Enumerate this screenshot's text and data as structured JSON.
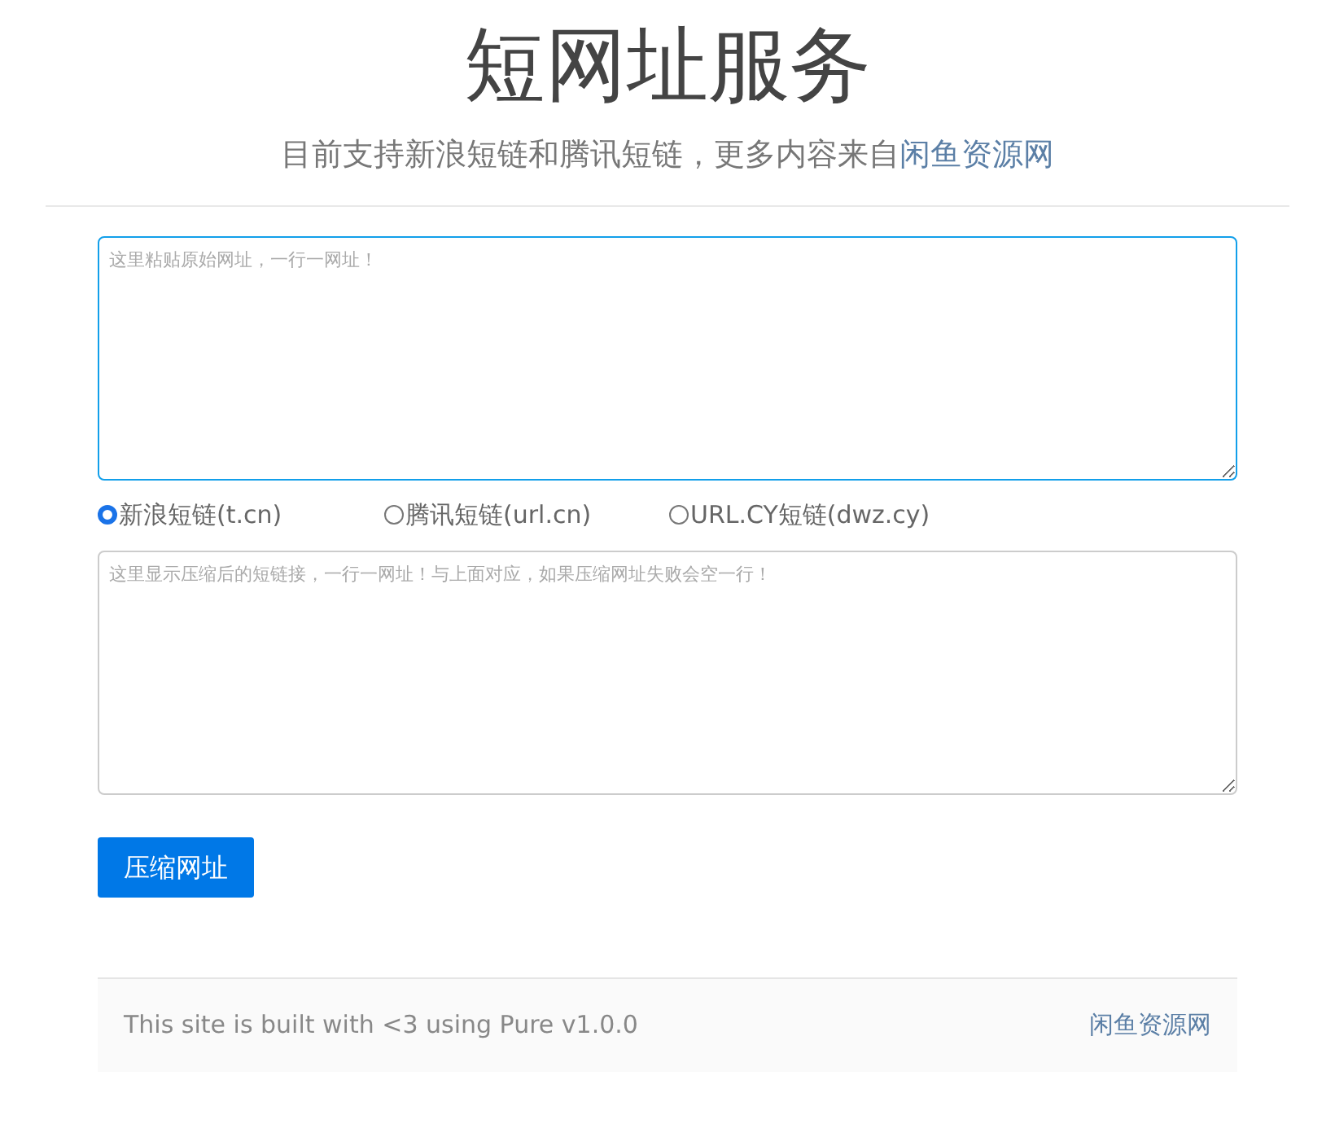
{
  "header": {
    "title": "短网址服务",
    "subtitle": "目前支持新浪短链和腾讯短链，更多内容来自",
    "subtitle_link": "闲鱼资源网"
  },
  "source_field": {
    "placeholder": "这里粘贴原始网址，一行一网址！",
    "focused": true
  },
  "services": [
    {
      "label": "新浪短链(t.cn)",
      "selected": true
    },
    {
      "label": "腾讯短链(url.cn)",
      "selected": false
    },
    {
      "label": "URL.CY短链(dwz.cy)",
      "selected": false
    }
  ],
  "result_field": {
    "placeholder": "这里显示压缩后的短链接，一行一网址！与上面对应，如果压缩网址失败会空一行！"
  },
  "submit_button": "压缩网址",
  "footer": {
    "text": "This site is built with <3 using Pure v1.0.0",
    "link": "闲鱼资源网"
  }
}
